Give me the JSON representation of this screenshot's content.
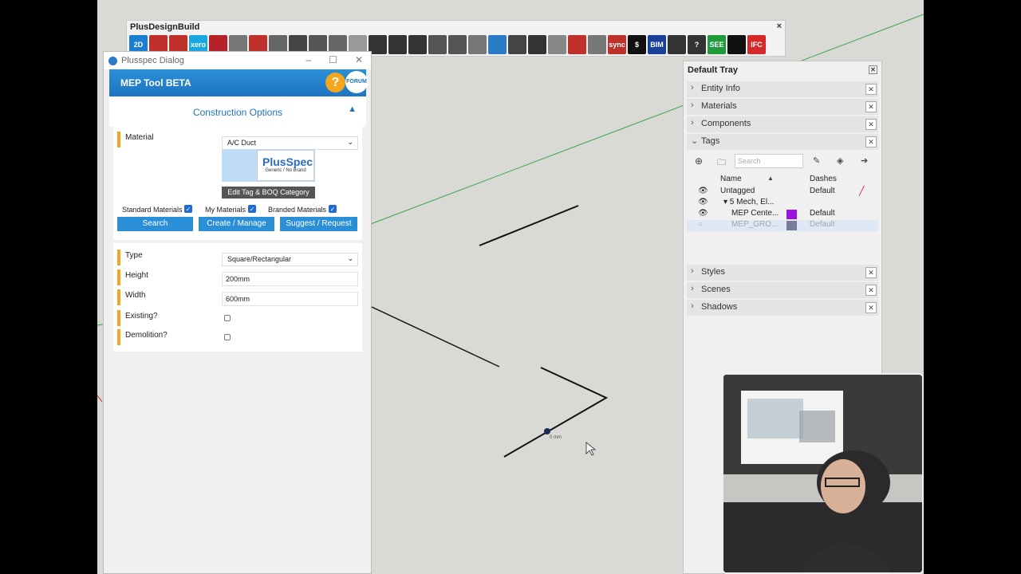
{
  "toolbar": {
    "title": "PlusDesignBuild",
    "icons": [
      {
        "name": "2d-mode-icon",
        "color": "#1a7fd0",
        "glyph": "2D"
      },
      {
        "name": "printer-red-icon",
        "color": "#c0302a",
        "glyph": ""
      },
      {
        "name": "document-red-icon",
        "color": "#c0302a",
        "glyph": ""
      },
      {
        "name": "xero-icon",
        "color": "#1aa7e0",
        "glyph": "xero"
      },
      {
        "name": "cube-red-icon",
        "color": "#b5222a",
        "glyph": ""
      },
      {
        "name": "layers-icon",
        "color": "#777777",
        "glyph": ""
      },
      {
        "name": "scissors-red-icon",
        "color": "#c0302a",
        "glyph": ""
      },
      {
        "name": "sheet-icon",
        "color": "#666666",
        "glyph": ""
      },
      {
        "name": "block-icon",
        "color": "#444444",
        "glyph": ""
      },
      {
        "name": "window-icon",
        "color": "#555555",
        "glyph": ""
      },
      {
        "name": "door-icon",
        "color": "#666666",
        "glyph": ""
      },
      {
        "name": "column-icon",
        "color": "#999999",
        "glyph": ""
      },
      {
        "name": "beam-icon",
        "color": "#333333",
        "glyph": ""
      },
      {
        "name": "corner-icon",
        "color": "#333333",
        "glyph": ""
      },
      {
        "name": "hexagon-icon",
        "color": "#333333",
        "glyph": ""
      },
      {
        "name": "stairs-icon",
        "color": "#555555",
        "glyph": ""
      },
      {
        "name": "camera-icon",
        "color": "#555555",
        "glyph": ""
      },
      {
        "name": "calendar-icon",
        "color": "#777777",
        "glyph": ""
      },
      {
        "name": "monitor-icon",
        "color": "#2a7ac6",
        "glyph": ""
      },
      {
        "name": "pipe-icon",
        "color": "#444444",
        "glyph": ""
      },
      {
        "name": "grid-icon",
        "color": "#333333",
        "glyph": ""
      },
      {
        "name": "grid-light-icon",
        "color": "#888888",
        "glyph": ""
      },
      {
        "name": "arrows-icon",
        "color": "#c0302a",
        "glyph": ""
      },
      {
        "name": "boxes-icon",
        "color": "#777777",
        "glyph": ""
      },
      {
        "name": "sync-icon",
        "color": "#c0302a",
        "glyph": "sync"
      },
      {
        "name": "dollar-icon",
        "color": "#111111",
        "glyph": "$"
      },
      {
        "name": "bim-mep-icon",
        "color": "#1a3f9a",
        "glyph": "BIM"
      },
      {
        "name": "hand-icon",
        "color": "#333333",
        "glyph": ""
      },
      {
        "name": "help-circle-icon",
        "color": "#333333",
        "glyph": "?"
      },
      {
        "name": "see-all-icon",
        "color": "#1e9b3a",
        "glyph": "SEE"
      },
      {
        "name": "stopwatch-icon",
        "color": "#111111",
        "glyph": ""
      },
      {
        "name": "ifc-icon",
        "color": "#d62a2a",
        "glyph": "IFC"
      }
    ]
  },
  "dialog": {
    "window_title": "Plusspec Dialog",
    "header": "MEP Tool BETA",
    "help_glyph": "?",
    "forum_label": "FORUM",
    "section_title": "Construction Options",
    "material_label": "Material",
    "material_value": "A/C Duct",
    "thumb_brand": "PlusSpec",
    "thumb_caption": "Generic / No Brand",
    "edit_tag_label": "Edit Tag & BOQ Category",
    "standard_materials": "Standard Materials",
    "my_materials": "My Materials",
    "branded_materials": "Branded Materials",
    "search_btn": "Search",
    "create_btn": "Create / Manage",
    "suggest_btn": "Suggest / Request",
    "type_label": "Type",
    "type_value": "Square/Rectangular",
    "height_label": "Height",
    "height_value": "200mm",
    "width_label": "Width",
    "width_value": "600mm",
    "existing_label": "Existing?",
    "demolition_label": "Demolition?"
  },
  "tray": {
    "title": "Default Tray",
    "sections": [
      "Entity Info",
      "Materials",
      "Components",
      "Tags"
    ],
    "search_placeholder": "Search",
    "col_name": "Name",
    "col_dashes": "Dashes",
    "tags": [
      {
        "name": "Untagged",
        "dashes": "Default",
        "swatch": "",
        "visible": true,
        "dim": false
      },
      {
        "name": "▾ 5 Mech, El...",
        "dashes": "",
        "swatch": "",
        "visible": true,
        "dim": false
      },
      {
        "name": "MEP Cente...",
        "dashes": "Default",
        "swatch": "#9b10e0",
        "visible": true,
        "dim": false
      },
      {
        "name": "MEP_GRO...",
        "dashes": "Default",
        "swatch": "#7a7a9a",
        "visible": false,
        "dim": true
      }
    ],
    "lower_sections": [
      "Styles",
      "Scenes",
      "Shadows"
    ]
  },
  "viewport": {
    "snap_label": "0 mm"
  }
}
